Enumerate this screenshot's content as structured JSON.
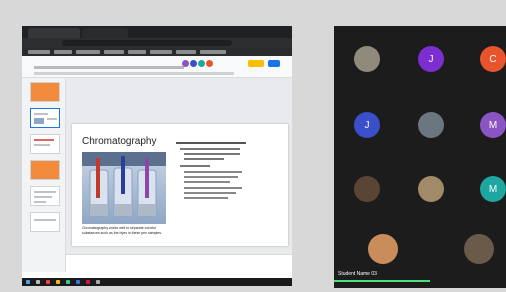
{
  "slides_app": {
    "document_title": "Chromatography",
    "slide": {
      "title": "Chromatography",
      "caption": "Chromatography works well to separate colorful substances such as the dyes in these pen samples."
    }
  },
  "gallery": {
    "participants": [
      {
        "initial": "J",
        "color": "#7b2fd0"
      },
      {
        "initial": "C",
        "color": "#e8542c"
      },
      {
        "initial": "J",
        "color": "#3a4fc9"
      },
      {
        "initial": "M",
        "color": "#8a54c2"
      },
      {
        "initial": "M",
        "color": "#1ea7a0"
      }
    ],
    "speaker_name": "Student Name 03"
  },
  "colors": {
    "gallery_bg": "#1c1c1c",
    "active_speaker": "#4ade80",
    "present_button": "#fbbc04",
    "share_button": "#1a73e8"
  }
}
